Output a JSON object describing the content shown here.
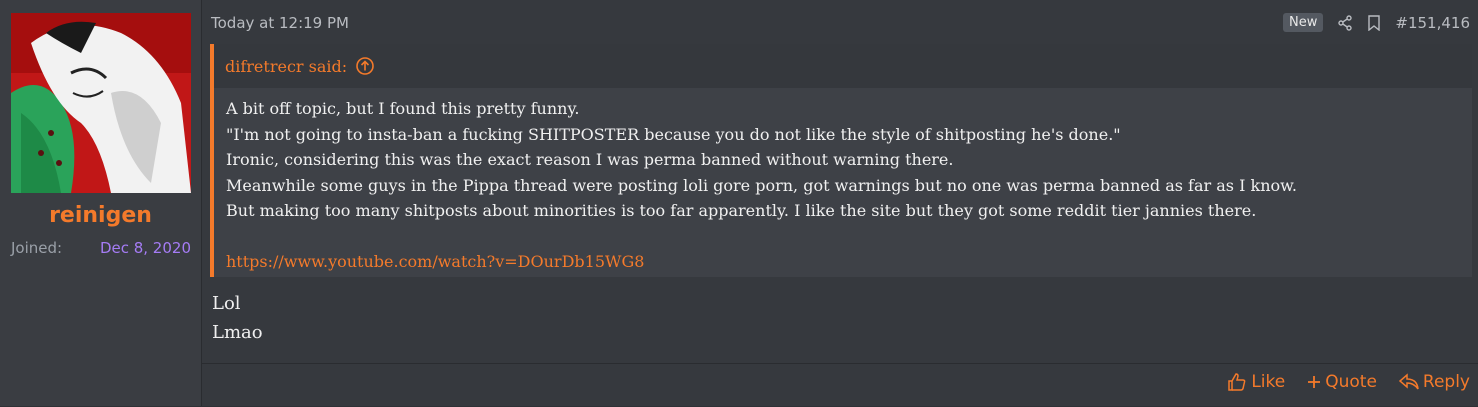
{
  "user": {
    "name": "reinigen",
    "joined_label": "Joined:",
    "joined_date": "Dec 8, 2020"
  },
  "post": {
    "timestamp": "Today at 12:19 PM",
    "badge": "New",
    "number": "#151,416",
    "quote": {
      "author": "difretrecr said:",
      "lines": [
        "A bit off topic, but I found this pretty funny.",
        "\"I'm not going to insta-ban a fucking SHITPOSTER because you do not like the style of shitposting he's done.\"",
        "Ironic, considering this was the exact reason I was perma banned without warning there.",
        "Meanwhile some guys in the Pippa thread were posting loli gore porn, got warnings but no one was perma banned as far as I know.",
        "But making too many shitposts about minorities is too far apparently. I like the site but they got some reddit tier jannies there."
      ],
      "link": "https://www.youtube.com/watch?v=DOurDb15WG8"
    },
    "body": [
      "Lol",
      "Lmao"
    ]
  },
  "actions": {
    "like": "Like",
    "quote": "Quote",
    "reply": "Reply"
  },
  "colors": {
    "accent": "#f47a2b",
    "joined_date": "#a57cf5"
  }
}
